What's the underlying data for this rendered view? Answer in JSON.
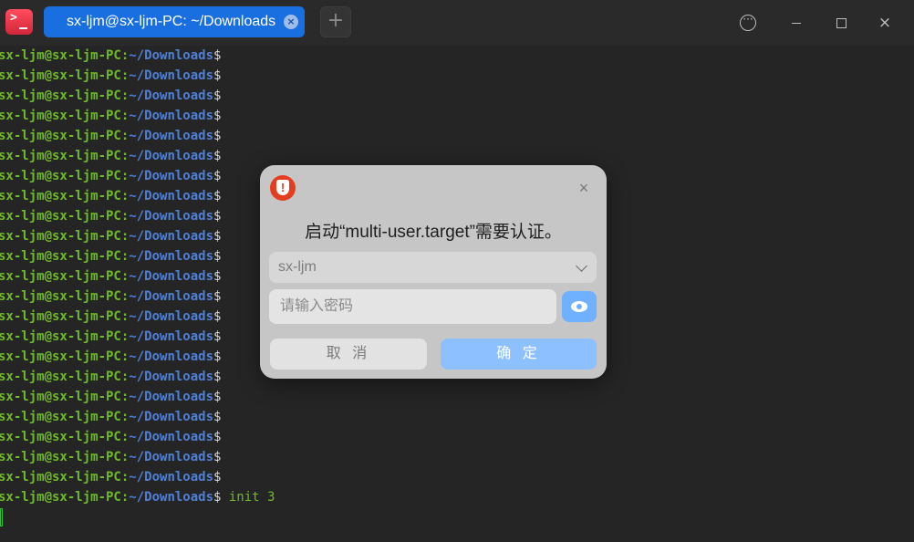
{
  "titlebar": {
    "app_icon": "terminal-icon",
    "app_icon_glyph": ">",
    "tab_title": "sx-ljm@sx-ljm-PC: ~/Downloads",
    "tab_close_glyph": "×",
    "new_tab_glyph": "+",
    "menu_glyph": "···",
    "close_glyph": "×"
  },
  "terminal": {
    "prompt_user": "sx-ljm@sx-ljm-PC",
    "prompt_colon": ":",
    "prompt_path": "~/Downloads",
    "prompt_symbol": "$",
    "last_command": " init 3",
    "lines": 23
  },
  "dialog": {
    "icon": "security-shield-icon",
    "message": "启动“multi-user.target”需要认证。",
    "close_glyph": "×",
    "user_select_value": "sx-ljm",
    "password_placeholder": "请输入密码",
    "cancel_label": "取 消",
    "confirm_label": "确 定"
  },
  "colors": {
    "prompt_user": "#6fba2a",
    "prompt_path": "#4f80d6",
    "tab_active": "#1a6fe0",
    "confirm_button": "#8cc0ff",
    "dialog_icon": "#e53d1f"
  }
}
